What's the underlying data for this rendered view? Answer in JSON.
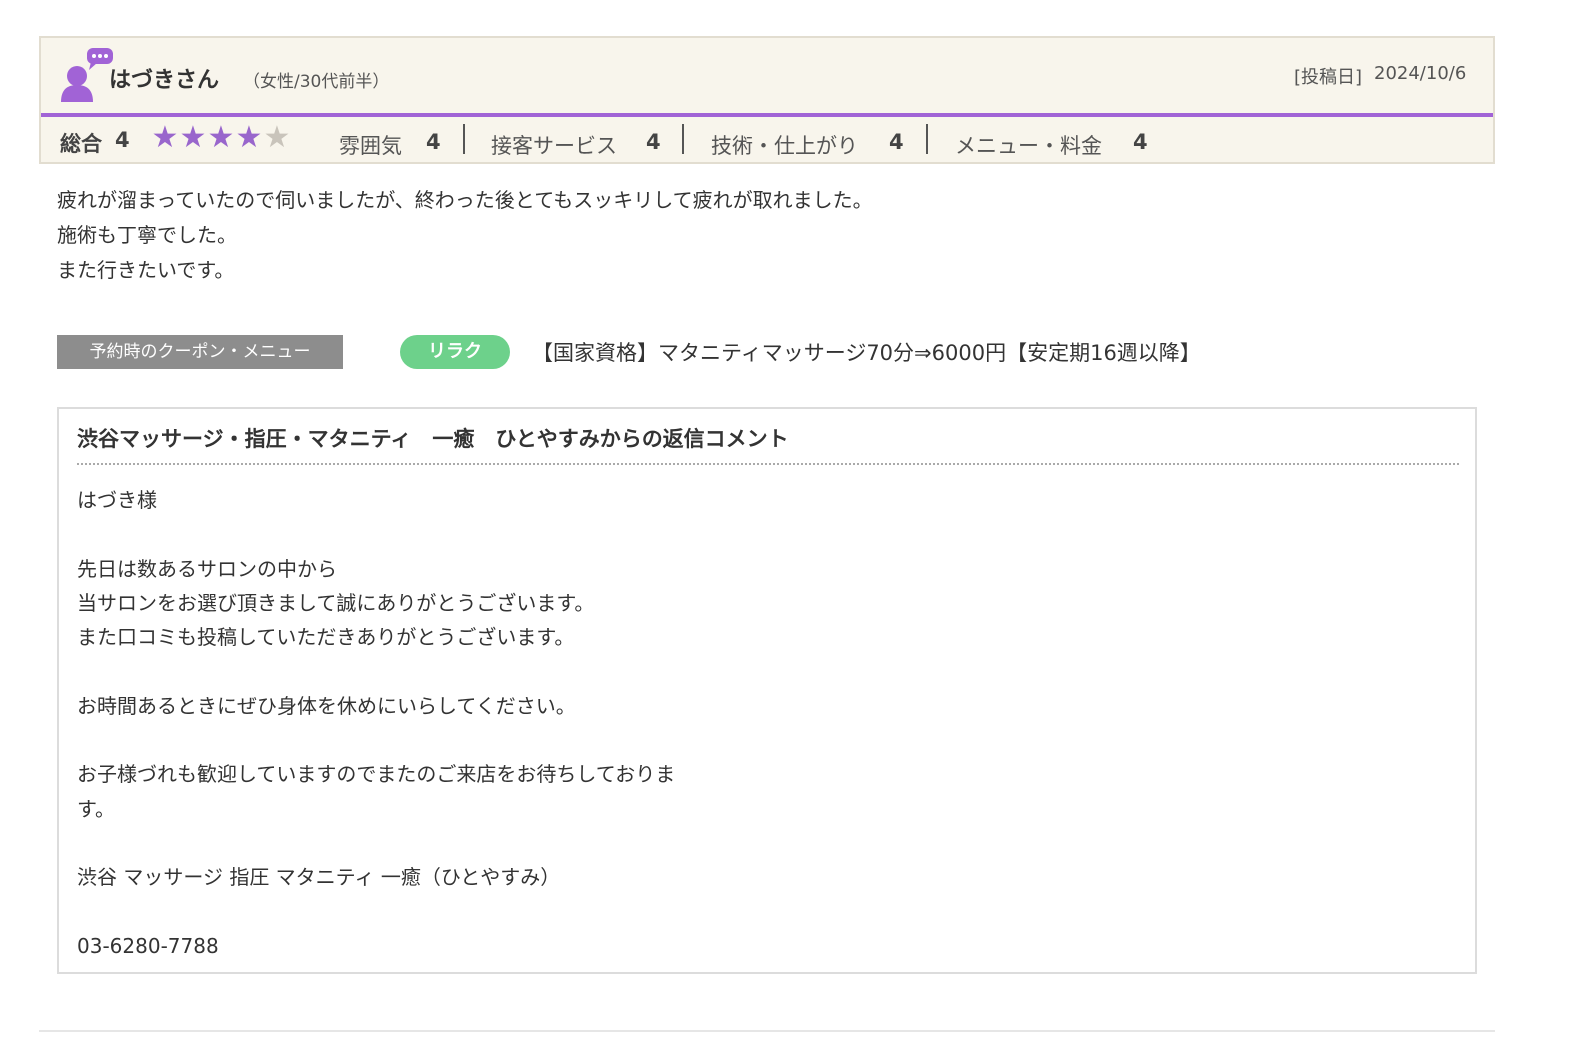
{
  "review": {
    "user_name": "はづきさん",
    "user_meta": "（女性/30代前半）",
    "post_date_label": "[投稿日]",
    "post_date": "2024/10/6",
    "overall_label": "総合",
    "overall_score": "4",
    "stars_on": 4,
    "stars_total": 5,
    "categories": [
      {
        "label": "雰囲気",
        "score": "4"
      },
      {
        "label": "接客サービス",
        "score": "4"
      },
      {
        "label": "技術・仕上がり",
        "score": "4"
      },
      {
        "label": "メニュー・料金",
        "score": "4"
      }
    ],
    "body_lines": [
      "疲れが溜まっていたので伺いましたが、終わった後とてもスッキリして疲れが取れました。",
      "施術も丁寧でした。",
      "また行きたいです。"
    ]
  },
  "coupon": {
    "label": "予約時のクーポン・メニュー",
    "tag": "リラク",
    "name": "【国家資格】マタニティマッサージ70分⇒6000円【安定期16週以降】"
  },
  "reply": {
    "title": "渋谷マッサージ・指圧・マタニティ　一癒　ひとやすみからの返信コメント",
    "lines": [
      "はづき様",
      "",
      "先日は数あるサロンの中から",
      "当サロンをお選び頂きまして誠にありがとうございます。",
      "また口コミも投稿していただきありがとうございます。",
      "",
      "お時間あるときにぜひ身体を休めにいらしてください。",
      "",
      "お子様づれも歓迎していますのでまたのご来店をお待ちしておりま",
      "す。",
      "",
      "渋谷 マッサージ 指圧 マタニティ 一癒（ひとやすみ）",
      "",
      "03-6280-7788"
    ]
  },
  "colors": {
    "accent": "#a163d6",
    "star_on": "#9966cc",
    "star_off": "#c9c4bb",
    "coupon_label_bg": "#8d8d8d",
    "coupon_tag_bg": "#6dd18b",
    "header_bg": "#f8f5ec"
  },
  "icons": {
    "user": "user-comment-icon",
    "star": "star-icon"
  }
}
